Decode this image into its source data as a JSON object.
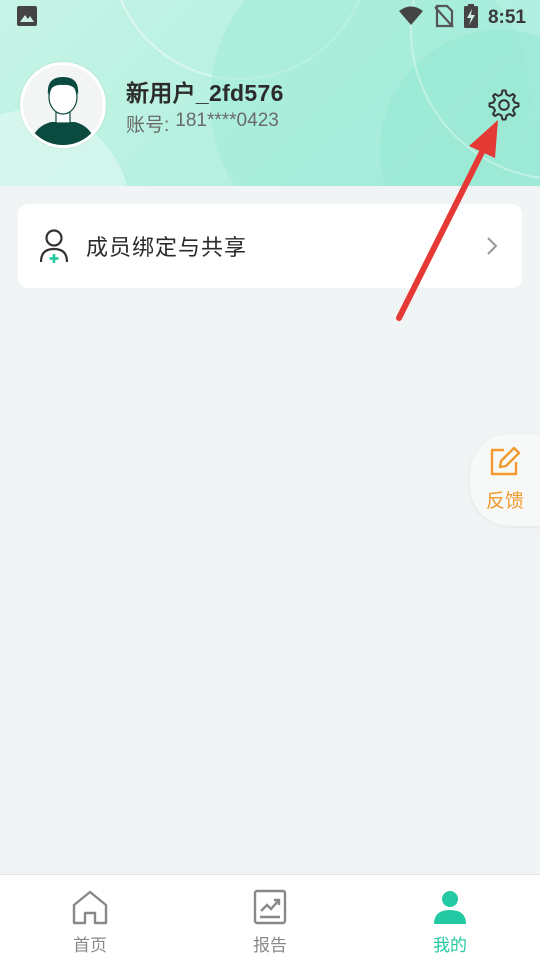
{
  "status_bar": {
    "time": "8:51",
    "icons": [
      "image-icon",
      "wifi-icon",
      "no-sim-icon",
      "battery-charging-icon"
    ]
  },
  "profile": {
    "username": "新用户_2fd576",
    "account_label": "账号:",
    "account_value": "181****0423",
    "settings_icon": "gear-icon"
  },
  "member_card": {
    "label": "成员绑定与共享",
    "icon": "person-add-icon"
  },
  "feedback": {
    "label": "反馈",
    "icon": "edit-icon"
  },
  "bottom_nav": {
    "items": [
      {
        "label": "首页",
        "icon": "home-icon",
        "active": false
      },
      {
        "label": "报告",
        "icon": "report-chart-icon",
        "active": false
      },
      {
        "label": "我的",
        "icon": "profile-icon",
        "active": true
      }
    ]
  },
  "colors": {
    "accent": "#22c9a2",
    "header_gradient_start": "#c7f4e7",
    "header_gradient_end": "#a9ede0",
    "page_background": "#f1f4f5",
    "annotation_arrow": "#e53935",
    "feedback_orange": "#f29a2e"
  }
}
